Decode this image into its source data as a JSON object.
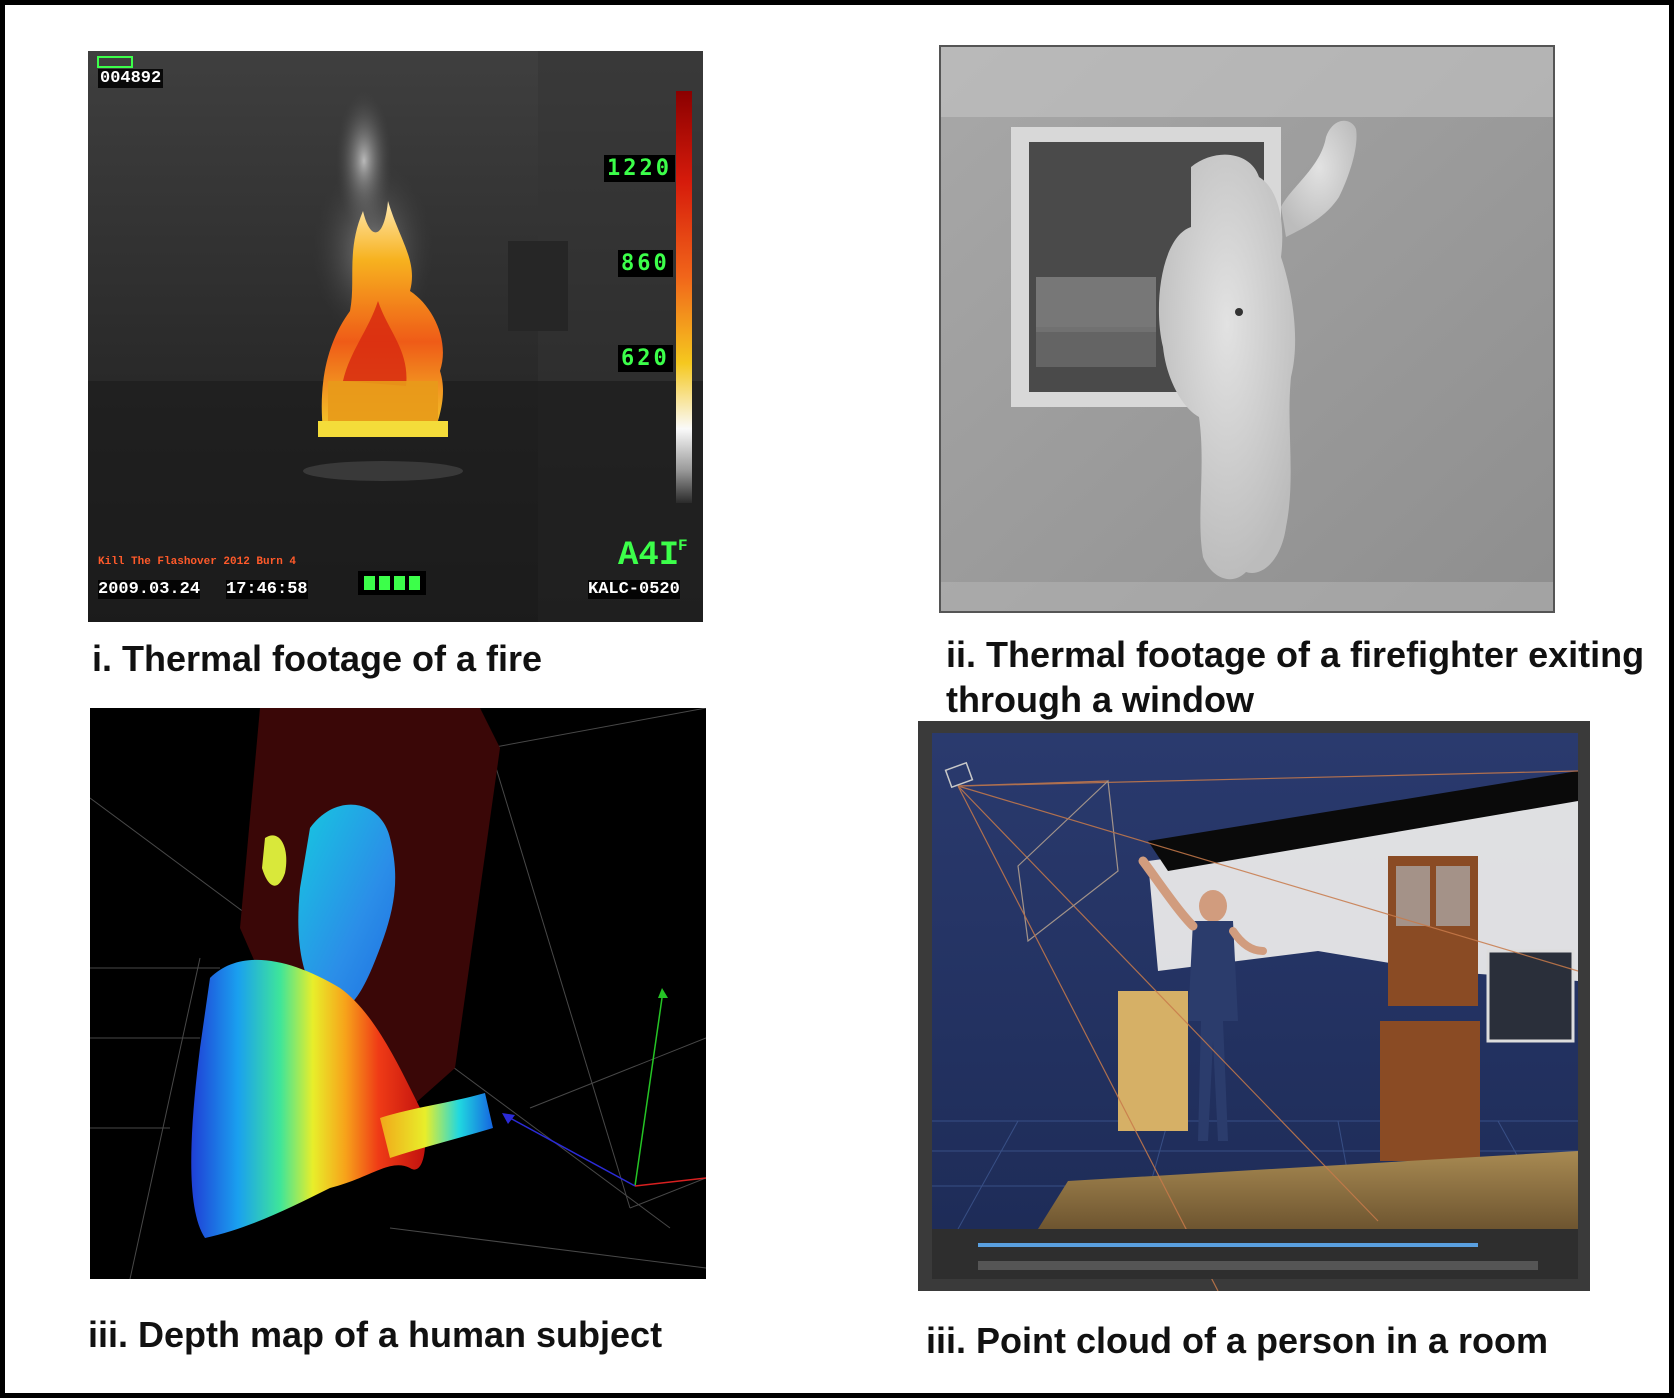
{
  "panel_fire": {
    "frame_counter": "004892",
    "scale_labels": [
      "1220",
      "860",
      "620"
    ],
    "temperature_readout": "A4I",
    "temperature_unit": "F",
    "event_label": "Kill The Flashover 2012 Burn 4",
    "date": "2009.03.24",
    "time": "17:46:58",
    "camera_id": "KALC-0520",
    "colors": {
      "hud_green": "#3cff4a",
      "event_label": "#ff5a2a"
    }
  },
  "captions": {
    "fire": "i. Thermal footage of a fire",
    "firefighter": "ii. Thermal footage of a firefighter exiting through a window",
    "depth_map": "iii. Depth map of a human subject",
    "point_cloud": "iii. Point cloud of a person in a  room"
  }
}
